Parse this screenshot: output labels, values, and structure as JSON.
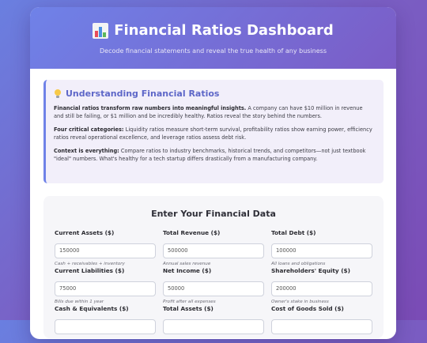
{
  "header": {
    "title": "Financial Ratios Dashboard",
    "subtitle": "Decode financial statements and reveal the true health of any business"
  },
  "info": {
    "title": "Understanding Financial Ratios",
    "p1_bold": "Financial ratios transform raw numbers into meaningful insights.",
    "p1_text": " A company can have $10 million in revenue and still be failing, or $1 million and be incredibly healthy. Ratios reveal the story behind the numbers.",
    "p2_bold": "Four critical categories:",
    "p2_text": " Liquidity ratios measure short-term survival, profitability ratios show earning power, efficiency ratios reveal operational excellence, and leverage ratios assess debt risk.",
    "p3_bold": "Context is everything:",
    "p3_text": " Compare ratios to industry benchmarks, historical trends, and competitors—not just textbook \"ideal\" numbers. What's healthy for a tech startup differs drastically from a manufacturing company."
  },
  "form": {
    "title": "Enter Your Financial Data",
    "fields": [
      {
        "label": "Current Assets ($)",
        "value": "150000",
        "help": "Cash + receivables + inventory"
      },
      {
        "label": "Total Revenue ($)",
        "value": "500000",
        "help": "Annual sales revenue"
      },
      {
        "label": "Total Debt ($)",
        "value": "100000",
        "help": "All loans and obligations"
      },
      {
        "label": "Current Liabilities ($)",
        "value": "75000",
        "help": "Bills due within 1 year"
      },
      {
        "label": "Net Income ($)",
        "value": "50000",
        "help": "Profit after all expenses"
      },
      {
        "label": "Shareholders' Equity ($)",
        "value": "200000",
        "help": "Owner's stake in business"
      },
      {
        "label": "Cash & Equivalents ($)",
        "value": "",
        "help": ""
      },
      {
        "label": "Total Assets ($)",
        "value": "",
        "help": ""
      },
      {
        "label": "Cost of Goods Sold ($)",
        "value": "",
        "help": ""
      }
    ]
  }
}
